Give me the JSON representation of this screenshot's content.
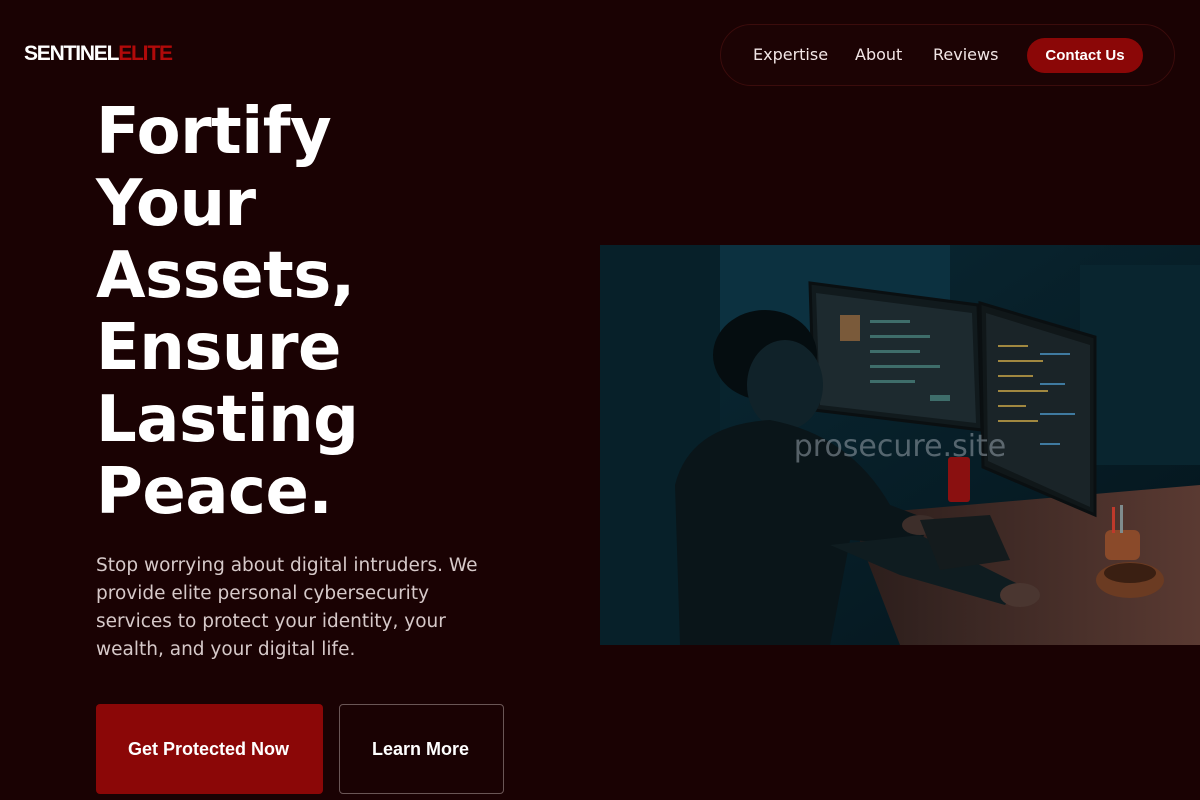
{
  "brand": {
    "name_primary": "SENTINEL",
    "name_accent": "ELITE",
    "accent_color": "#b10a0a"
  },
  "nav": {
    "items": [
      {
        "label": "Expertise"
      },
      {
        "label": "About"
      },
      {
        "label": "Reviews"
      }
    ],
    "cta_label": "Contact Us"
  },
  "hero": {
    "title_lines": [
      "Fortify",
      "Your",
      "Assets,",
      "Ensure",
      "Lasting",
      "Peace."
    ],
    "description": "Stop worrying about digital intruders. We provide elite personal cybersecurity services to protect your identity, your wealth, and your digital life.",
    "primary_button": "Get Protected Now",
    "secondary_button": "Learn More",
    "image_watermark": "prosecure.site"
  },
  "colors": {
    "background": "#1a0203",
    "primary": "#8b0707"
  }
}
